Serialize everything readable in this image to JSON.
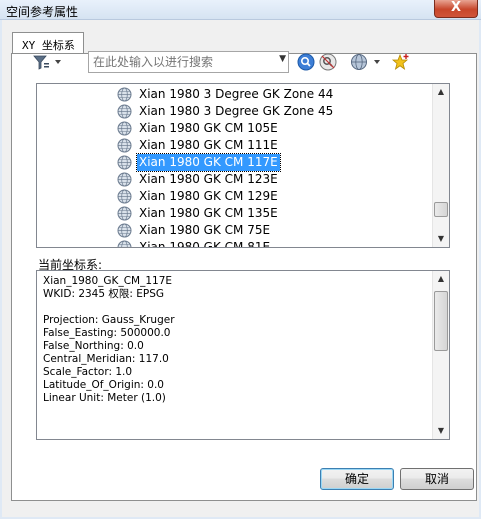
{
  "window": {
    "title": "空间参考属性",
    "close_label": "X"
  },
  "tabs": [
    {
      "label": "XY 坐标系"
    }
  ],
  "toolbar": {
    "search_placeholder": "在此处输入以进行搜索",
    "icons": [
      "filter-icon",
      "search-icon",
      "clear-search-icon",
      "globe-add-icon",
      "star-icon"
    ]
  },
  "tree": {
    "items": [
      {
        "label": "Xian 1980 3 Degree GK Zone 44",
        "selected": false
      },
      {
        "label": "Xian 1980 3 Degree GK Zone 45",
        "selected": false
      },
      {
        "label": "Xian 1980 GK CM 105E",
        "selected": false
      },
      {
        "label": "Xian 1980 GK CM 111E",
        "selected": false
      },
      {
        "label": "Xian 1980 GK CM 117E",
        "selected": true
      },
      {
        "label": "Xian 1980 GK CM 123E",
        "selected": false
      },
      {
        "label": "Xian 1980 GK CM 129E",
        "selected": false
      },
      {
        "label": "Xian 1980 GK CM 135E",
        "selected": false
      },
      {
        "label": "Xian 1980 GK CM 75E",
        "selected": false
      },
      {
        "label": "Xian 1980 GK CM 81E",
        "selected": false
      }
    ]
  },
  "current": {
    "label": "当前坐标系:",
    "details": "Xian_1980_GK_CM_117E\nWKID: 2345 权限: EPSG\n\nProjection: Gauss_Kruger\nFalse_Easting: 500000.0\nFalse_Northing: 0.0\nCentral_Meridian: 117.0\nScale_Factor: 1.0\nLatitude_Of_Origin: 0.0\nLinear Unit: Meter (1.0)"
  },
  "buttons": {
    "ok": "确定",
    "cancel": "取消"
  }
}
